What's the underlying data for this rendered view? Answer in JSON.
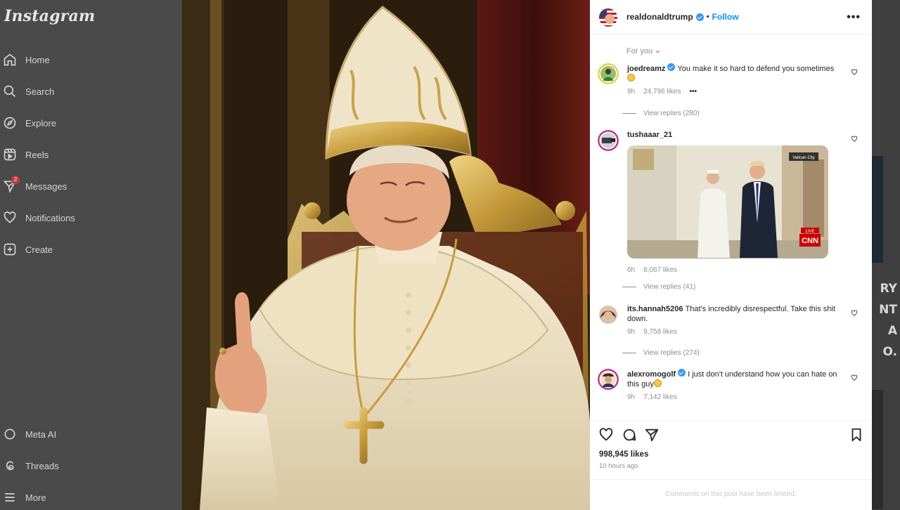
{
  "sidebar": {
    "logo": "Instagram",
    "items": [
      {
        "label": "Home",
        "icon": "home-icon"
      },
      {
        "label": "Search",
        "icon": "search-icon"
      },
      {
        "label": "Explore",
        "icon": "compass-icon"
      },
      {
        "label": "Reels",
        "icon": "reels-icon"
      },
      {
        "label": "Messages",
        "icon": "messenger-icon",
        "badge": "2"
      },
      {
        "label": "Notifications",
        "icon": "heart-icon"
      },
      {
        "label": "Create",
        "icon": "plus-square-icon"
      }
    ],
    "bottom_items": [
      {
        "label": "Meta AI",
        "icon": "meta-ai-icon"
      },
      {
        "label": "Threads",
        "icon": "threads-icon"
      },
      {
        "label": "More",
        "icon": "menu-icon"
      }
    ]
  },
  "background_page": {
    "letters": [
      "RY",
      "NT",
      "A",
      "O."
    ]
  },
  "post": {
    "username": "realdonaldtrump",
    "verified": true,
    "separator": "•",
    "follow_label": "Follow",
    "more_label": "•••",
    "sort_label": "For you",
    "comments": [
      {
        "username": "joedreamz",
        "verified": true,
        "text": "You make it so hard to defend you sometimes",
        "emoji": "grinning-sweat-emoji",
        "age": "9h",
        "likes": "24,796 likes",
        "more": "•••",
        "replies": "View replies (280)"
      },
      {
        "username": "tushaaar_21",
        "verified": false,
        "text": "",
        "age": "6h",
        "likes": "6,067 likes",
        "replies": "View replies (41)",
        "attachment": {
          "location_tag": "Vatican City",
          "live_label": "LIVE",
          "network_label": "CNN"
        }
      },
      {
        "username": "its.hannah5206",
        "verified": false,
        "text": "That's incredibly disrespectful. Take this shit down.",
        "age": "9h",
        "likes": "9,758 likes",
        "replies": "View replies (274)"
      },
      {
        "username": "alexromogolf",
        "verified": true,
        "text": "I just don't understand how you can hate on this guy",
        "emoji": "grinning-sweat-emoji",
        "age": "9h",
        "likes": "7,142 likes"
      }
    ],
    "likes_total": "998,945 likes",
    "posted": "10 hours ago",
    "comments_limited": "Comments on this post have been limited."
  },
  "colors": {
    "link_blue": "#0095f6",
    "verified_blue": "#3897f0",
    "sidebar_dim": "#4a4a4a",
    "badge_red": "#c0393b"
  }
}
